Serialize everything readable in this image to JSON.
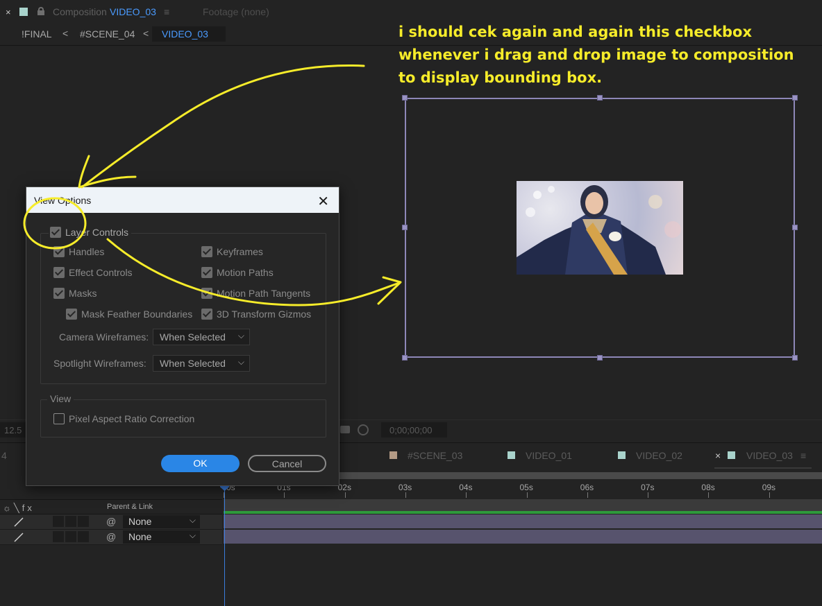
{
  "comp_panel": {
    "close": "×",
    "comp_label": "Composition",
    "comp_name": "VIDEO_03",
    "menu": "≡",
    "footage": "Footage  (none)",
    "breadcrumbs": [
      "!FINAL",
      "#SCENE_04",
      "VIDEO_03"
    ],
    "crumb_separator": "<"
  },
  "annotation": {
    "lines": [
      "i should cek again and again this checkbox",
      "whenever i drag and drop image to composition",
      "to display bounding box."
    ],
    "color": "#f6ec2a"
  },
  "viewer_bar": {
    "zoom": "12.5",
    "timecode": "0;00;00;00"
  },
  "timeline": {
    "left_tab_fragment": "4",
    "tabs": [
      {
        "label": "#SCENE_03",
        "color": "#b39a85"
      },
      {
        "label": "VIDEO_01",
        "color": "#a9d3cc"
      },
      {
        "label": "VIDEO_02",
        "color": "#a9d3cc"
      },
      {
        "label": "VIDEO_03",
        "color": "#a9d3cc",
        "active": true
      }
    ],
    "ruler": [
      "0s",
      "01s",
      "02s",
      "03s",
      "04s",
      "05s",
      "06s",
      "07s",
      "08s",
      "09s"
    ],
    "header_icons": "☼╲fx",
    "parent_link_label": "Parent & Link",
    "layers": [
      {
        "parent": "None"
      },
      {
        "parent": "None"
      }
    ]
  },
  "dialog": {
    "title": "View Options",
    "close": "✕",
    "layer_controls": {
      "label": "Layer Controls",
      "checked": true
    },
    "left_checks": [
      {
        "label": "Handles",
        "checked": true
      },
      {
        "label": "Effect Controls",
        "checked": true
      },
      {
        "label": "Masks",
        "checked": true
      }
    ],
    "mask_feather": {
      "label": "Mask Feather Boundaries",
      "checked": true
    },
    "right_checks": [
      {
        "label": "Keyframes",
        "checked": true
      },
      {
        "label": "Motion Paths",
        "checked": true
      },
      {
        "label": "Motion Path Tangents",
        "checked": true
      },
      {
        "label": "3D Transform Gizmos",
        "checked": true
      }
    ],
    "camera_wireframes": {
      "label": "Camera Wireframes:",
      "value": "When Selected"
    },
    "spotlight_wireframes": {
      "label": "Spotlight Wireframes:",
      "value": "When Selected"
    },
    "view_group_title": "View",
    "pixel_aspect": {
      "label": "Pixel Aspect Ratio Correction",
      "checked": false
    },
    "ok": "OK",
    "cancel": "Cancel"
  }
}
